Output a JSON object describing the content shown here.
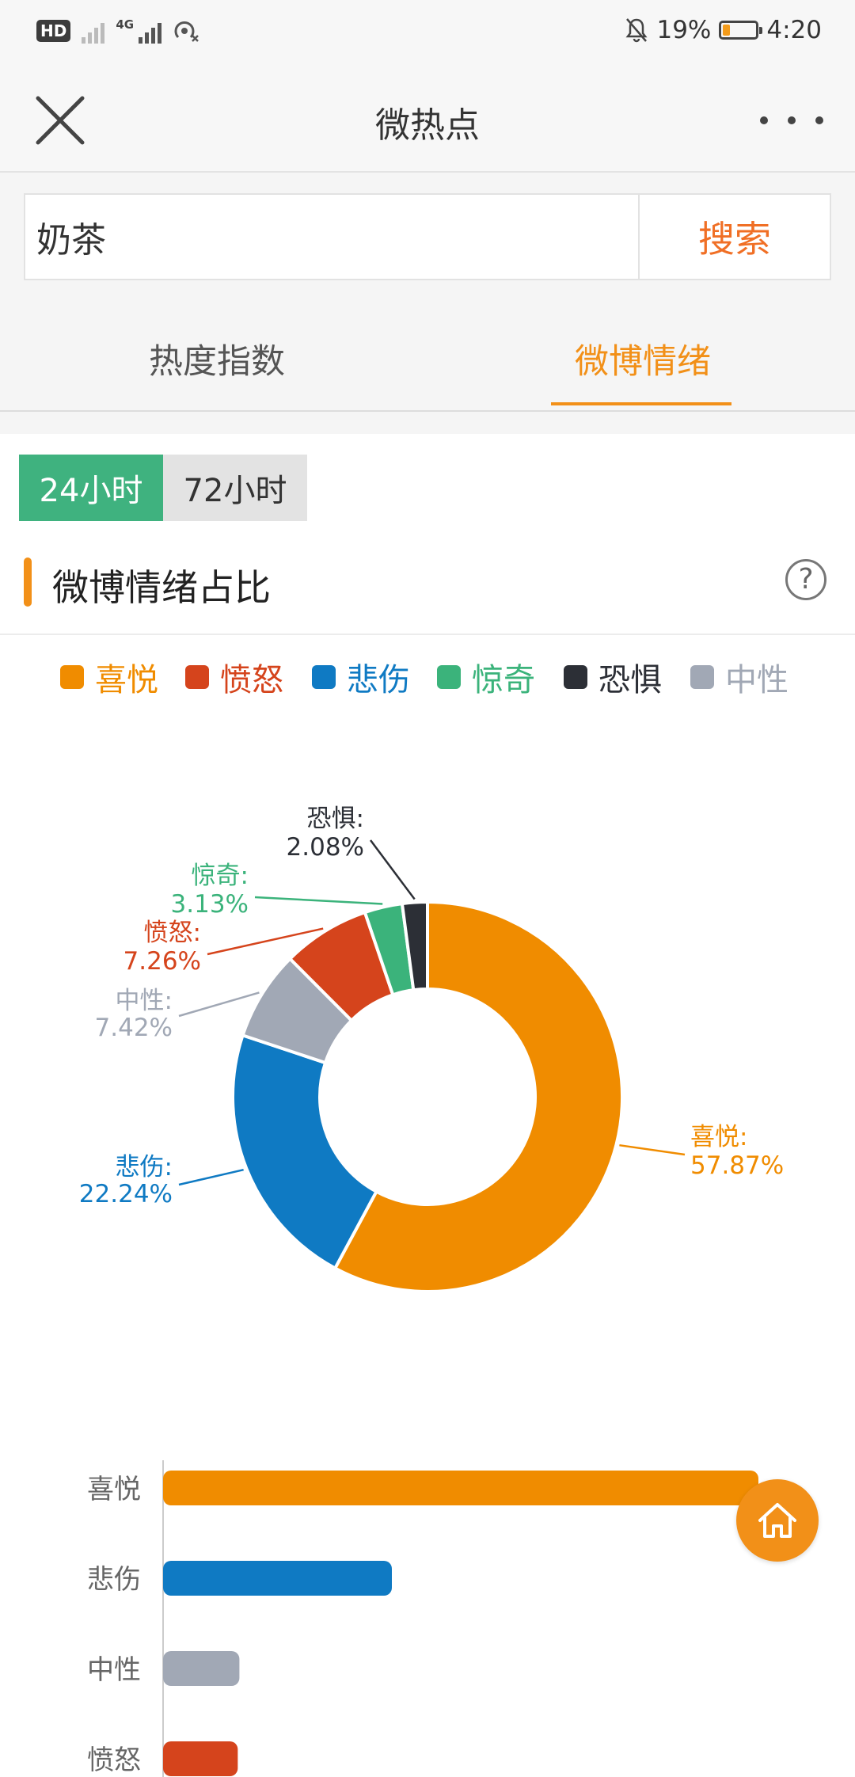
{
  "status_bar": {
    "hd_badge": "HD",
    "network_type": "4G",
    "battery_percent": "19%",
    "time": "4:20",
    "icons": [
      "hd-icon",
      "signal-icon",
      "hotspot-icon",
      "mute-bell-icon",
      "battery-icon"
    ]
  },
  "app_bar": {
    "title": "微热点",
    "close_icon": "close-icon",
    "more_icon": "more-icon"
  },
  "search": {
    "value": "奶茶",
    "placeholder": "",
    "button_label": "搜索"
  },
  "tabs": [
    {
      "label": "热度指数",
      "active": false
    },
    {
      "label": "微博情绪",
      "active": true
    }
  ],
  "time_toggle": [
    {
      "label": "24小时",
      "active": true
    },
    {
      "label": "72小时",
      "active": false
    }
  ],
  "section": {
    "title": "微博情绪占比",
    "help_symbol": "?"
  },
  "colors": {
    "accent": "#f29018",
    "green": "#3fb27f",
    "search_red": "#f06f25"
  },
  "chart_data": [
    {
      "type": "pie",
      "title": "",
      "legend": [
        {
          "name": "喜悦",
          "color": "#f08c00"
        },
        {
          "name": "愤怒",
          "color": "#d5441c"
        },
        {
          "name": "悲伤",
          "color": "#0f7ac3"
        },
        {
          "name": "惊奇",
          "color": "#3bb37b"
        },
        {
          "name": "恐惧",
          "color": "#2c2f36"
        },
        {
          "name": "中性",
          "color": "#a1a8b5"
        }
      ],
      "slices": [
        {
          "name": "喜悦",
          "value": 57.87,
          "label_name": "喜悦:",
          "label_value": "57.87%",
          "color": "#f08c00"
        },
        {
          "name": "悲伤",
          "value": 22.24,
          "label_name": "悲伤:",
          "label_value": "22.24%",
          "color": "#0f7ac3"
        },
        {
          "name": "中性",
          "value": 7.42,
          "label_name": "中性:",
          "label_value": "7.42%",
          "color": "#a1a8b5"
        },
        {
          "name": "愤怒",
          "value": 7.26,
          "label_name": "愤怒:",
          "label_value": "7.26%",
          "color": "#d5441c"
        },
        {
          "name": "惊奇",
          "value": 3.13,
          "label_name": "惊奇:",
          "label_value": "3.13%",
          "color": "#3bb37b"
        },
        {
          "name": "恐惧",
          "value": 2.08,
          "label_name": "恐惧:",
          "label_value": "2.08%",
          "color": "#2c2f36"
        }
      ],
      "donut": true
    },
    {
      "type": "bar",
      "orientation": "horizontal",
      "categories": [
        "喜悦",
        "悲伤",
        "中性",
        "愤怒"
      ],
      "values": [
        57.87,
        22.24,
        7.42,
        7.26
      ],
      "colors": [
        "#f08c00",
        "#0f7ac3",
        "#a1a8b5",
        "#d5441c"
      ],
      "xlim": [
        0,
        57.87
      ]
    }
  ],
  "fab": {
    "icon": "home-icon"
  }
}
